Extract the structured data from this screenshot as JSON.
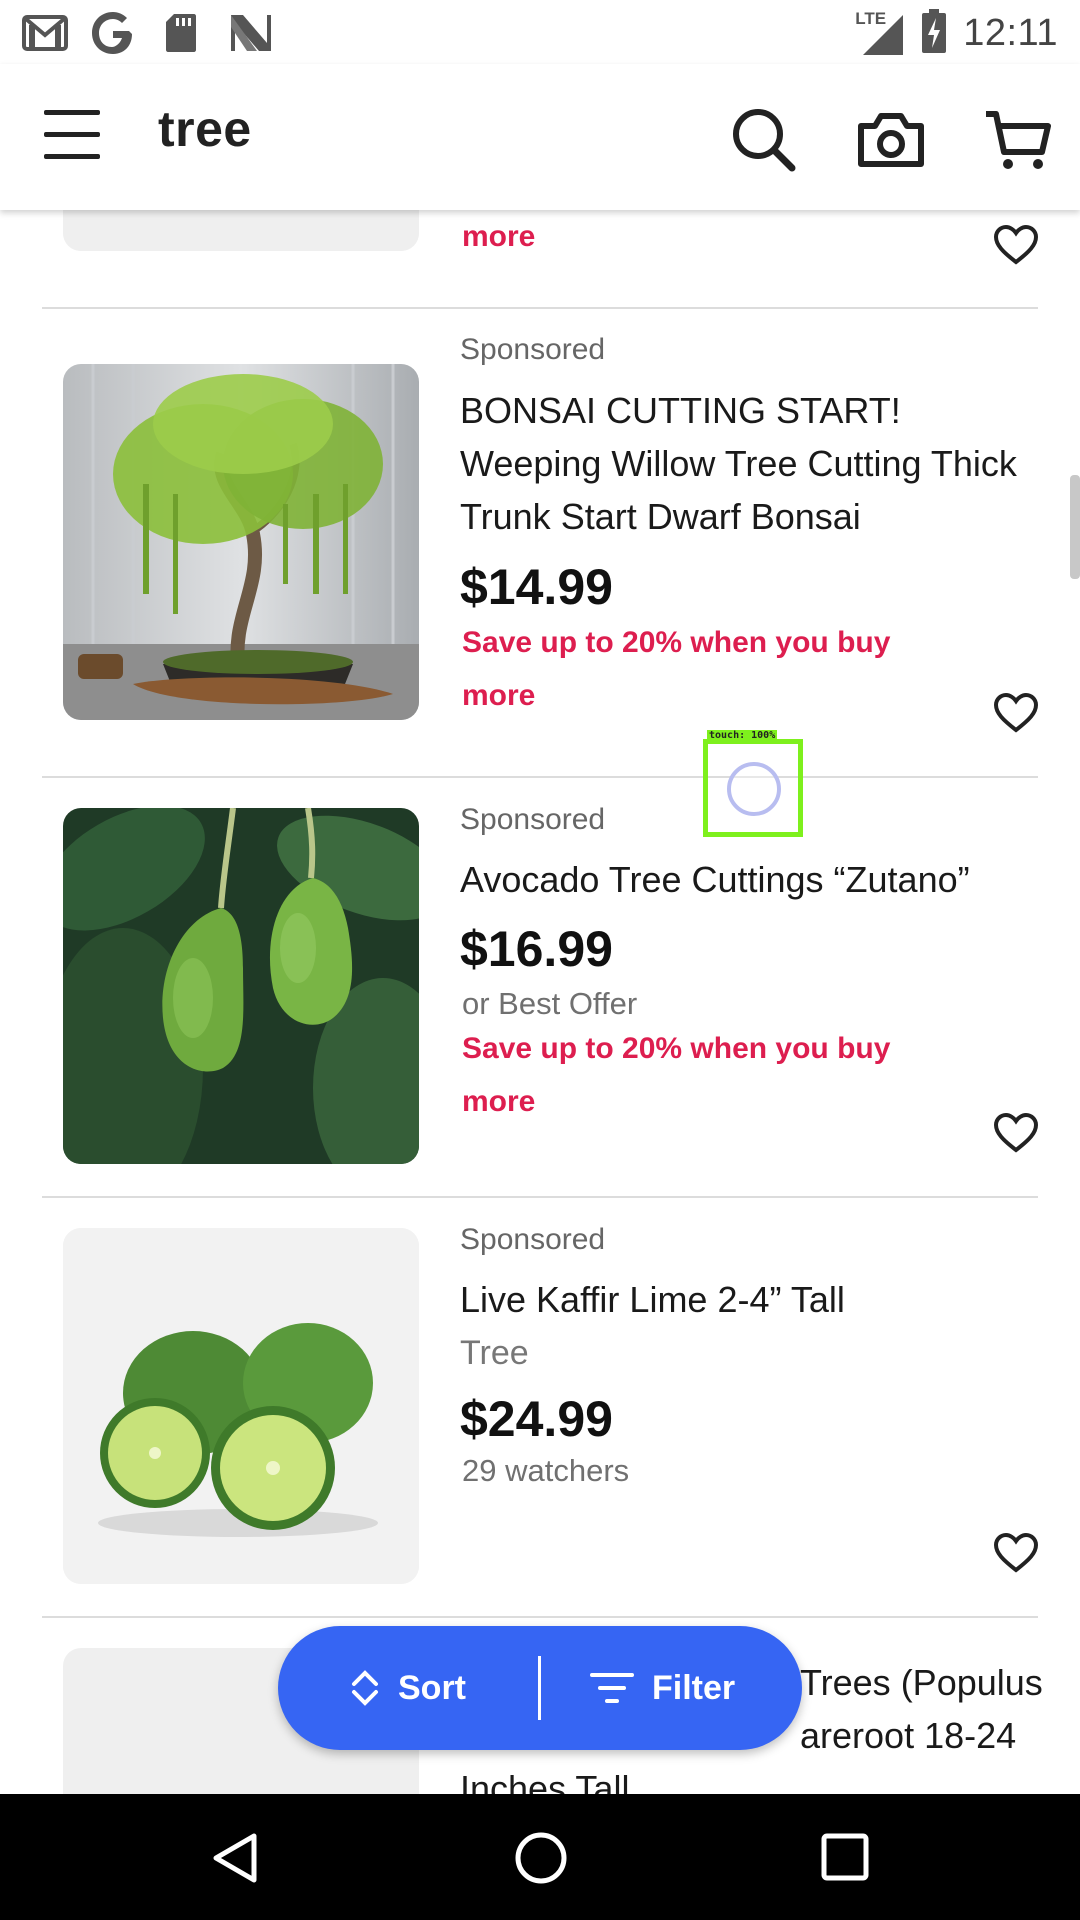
{
  "status_bar": {
    "time": "12:11",
    "network": "LTE",
    "left_icons": [
      "gmail-icon",
      "google-icon",
      "sd-card-icon",
      "n-icon"
    ]
  },
  "app_bar": {
    "title": "tree",
    "icons": [
      "menu-icon",
      "search-icon",
      "camera-icon",
      "cart-icon"
    ]
  },
  "partial_item": {
    "promo_tail": "more"
  },
  "items": [
    {
      "sponsored": "Sponsored",
      "title": "BONSAI CUTTING START! Weeping Willow Tree Cutting Thick Trunk Start Dwarf Bonsai",
      "price": "$14.99",
      "promo": "Save up to 20% when you buy more"
    },
    {
      "sponsored": "Sponsored",
      "title": "Avocado Tree Cuttings “Zutano”",
      "price": "$16.99",
      "note": "or Best Offer",
      "promo": "Save up to 20% when you buy more"
    },
    {
      "sponsored": "Sponsored",
      "title": "Live Kaffir Lime 2-4” Tall",
      "subtitle": "Tree",
      "price": "$24.99",
      "note": "29 watchers"
    },
    {
      "title_partial": "Trees (Populus",
      "title_partial_2": "areroot 18-24",
      "title_partial_3": "Inches Tall"
    }
  ],
  "controls": {
    "sort_label": "Sort",
    "filter_label": "Filter"
  },
  "touch_overlay": {
    "label": "touch: 100%"
  },
  "colors": {
    "accent": "#3665f3",
    "promo": "#dd1e4f",
    "touch": "#7ef01d"
  }
}
